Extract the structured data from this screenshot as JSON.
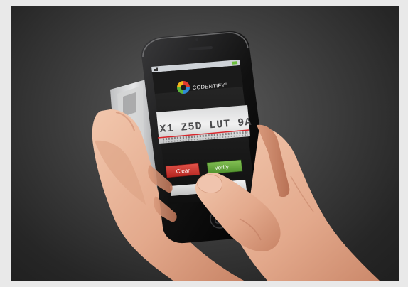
{
  "app": {
    "brand_name": "CODENTIFY",
    "brand_suffix": "®",
    "scanned_code_text": "X1 Z5D LUT 9A",
    "buttons": {
      "clear_label": "Clear",
      "verify_label": "Verify"
    },
    "colors": {
      "clear": "#c9312b",
      "verify": "#5fa23a",
      "scan_line": "#d8262b"
    }
  },
  "icons": [
    "codentify-logo-icon",
    "signal-icon",
    "battery-icon",
    "home-button-icon"
  ]
}
